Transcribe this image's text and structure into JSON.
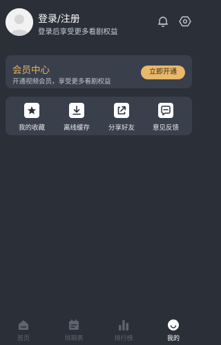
{
  "header": {
    "title": "登录/注册",
    "subtitle": "登录后享受更多看剧权益"
  },
  "vip": {
    "title": "会员中心",
    "subtitle": "开通视频会员，享受更多看剧权益",
    "button": "立即开通"
  },
  "functions": [
    {
      "label": "我的收藏",
      "icon": "star-icon"
    },
    {
      "label": "离线缓存",
      "icon": "download-icon"
    },
    {
      "label": "分享好友",
      "icon": "share-icon"
    },
    {
      "label": "意见反馈",
      "icon": "feedback-icon"
    }
  ],
  "tabs": [
    {
      "label": "首页",
      "icon": "home-icon",
      "active": false
    },
    {
      "label": "排期表",
      "icon": "calendar-icon",
      "active": false
    },
    {
      "label": "排行榜",
      "icon": "ranking-icon",
      "active": false
    },
    {
      "label": "我的",
      "icon": "profile-icon",
      "active": true
    }
  ],
  "colors": {
    "background": "#2b2f38",
    "card": "#3a3f4c",
    "accent_gold": "#e8b55a",
    "button_gold": "#e8b96a",
    "tab_inactive": "#5e6370"
  }
}
